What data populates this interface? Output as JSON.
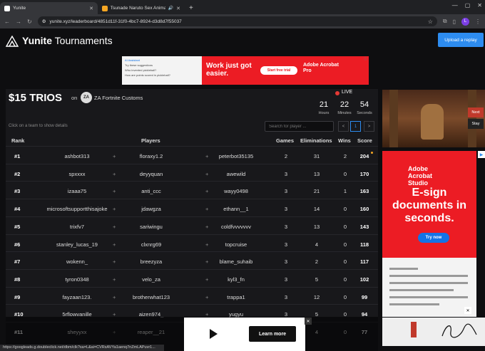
{
  "browser": {
    "tabs": [
      {
        "title": "Yunite",
        "active": true
      },
      {
        "title": "Tsunade Naruto Sex Anima",
        "active": false
      }
    ],
    "url": "yunite.xyz/leaderboard/4851d11f-31f0-4bc7-8924-d3d8d7f55037",
    "profile_initial": "L"
  },
  "site": {
    "brand_bold": "Yunite",
    "brand_rest": "Tournaments",
    "upload_label": "Upload a replay"
  },
  "top_ad": {
    "panel_lines": [
      "AI Assistant",
      "Try these suggestions",
      "Who invented pickleball?",
      "How are points scored in pickleball?"
    ],
    "headline": "Work just got easier.",
    "cta": "Start free trial",
    "brand": "Adobe Acrobat Pro"
  },
  "event": {
    "title": "$15 TRIOS",
    "on": "on",
    "org_logo": "ZA",
    "org_name": "ZA Fortnite Customs",
    "live_label": "LIVE",
    "timer": [
      {
        "value": "21",
        "label": "Hours"
      },
      {
        "value": "22",
        "label": "Minutes"
      },
      {
        "value": "54",
        "label": "Seconds"
      }
    ],
    "hint": "Click on a team to show details",
    "search_placeholder": "Search for player ...",
    "page": "1",
    "prev": "<",
    "next": ">"
  },
  "table": {
    "headers": {
      "rank": "Rank",
      "players": "Players",
      "games": "Games",
      "elims": "Eliminations",
      "wins": "Wins",
      "score": "Score"
    },
    "rows": [
      {
        "rank": "#1",
        "p1": "ashbot313",
        "p2": "floraxy1.2",
        "p3": "peterbot35135",
        "games": "2",
        "elims": "31",
        "wins": "2",
        "score": "204"
      },
      {
        "rank": "#2",
        "p1": "spxxxx",
        "p2": "deyyquan",
        "p3": "awewild",
        "games": "3",
        "elims": "13",
        "wins": "0",
        "score": "170"
      },
      {
        "rank": "#3",
        "p1": "izaaa75",
        "p2": "anti_ccc",
        "p3": "wayy0498",
        "games": "3",
        "elims": "21",
        "wins": "1",
        "score": "163"
      },
      {
        "rank": "#4",
        "p1": "microsoftsupportthisajoke",
        "p2": "jdawgza",
        "p3": "ethann__1",
        "games": "3",
        "elims": "14",
        "wins": "0",
        "score": "160"
      },
      {
        "rank": "#5",
        "p1": "trixfv7",
        "p2": "sariwingu",
        "p3": "coldfvvvvvvv",
        "games": "3",
        "elims": "13",
        "wins": "0",
        "score": "143"
      },
      {
        "rank": "#6",
        "p1": "stanley_lucas_19",
        "p2": "clxnrg69",
        "p3": "topcruise",
        "games": "3",
        "elims": "4",
        "wins": "0",
        "score": "118"
      },
      {
        "rank": "#7",
        "p1": "wokenn_",
        "p2": "breezyza",
        "p3": "blame_suhaib",
        "games": "3",
        "elims": "2",
        "wins": "0",
        "score": "117"
      },
      {
        "rank": "#8",
        "p1": "tyron0348",
        "p2": "velo_za",
        "p3": "kyl3_fn",
        "games": "3",
        "elims": "5",
        "wins": "0",
        "score": "102"
      },
      {
        "rank": "#9",
        "p1": "fayzaan123.",
        "p2": "brotherwhat123",
        "p3": "trappa1",
        "games": "3",
        "elims": "12",
        "wins": "0",
        "score": "99"
      },
      {
        "rank": "#10",
        "p1": "5rflowvanille",
        "p2": "aizen974_",
        "p3": "yugyu",
        "games": "3",
        "elims": "5",
        "wins": "0",
        "score": "94"
      },
      {
        "rank": "#11",
        "p1": "sheyyxx",
        "p2": "reaper__21",
        "p3": "",
        "games": "3",
        "elims": "4",
        "wins": "0",
        "score": "77"
      }
    ],
    "plus": "+"
  },
  "side": {
    "next_label": "Next",
    "stay_label": "Stay",
    "ad_brand": "Adobe Acrobat Studio",
    "ad_headline": "E-sign documents in seconds.",
    "ad_cta": "Try now"
  },
  "bottom_ad": {
    "cta": "Learn more"
  },
  "status_url": "https://googleads.g.doubleclick.net/dbm/clk?sa=L&ai=CVRsAVYa1aenq7nZmLAPuvr1..."
}
